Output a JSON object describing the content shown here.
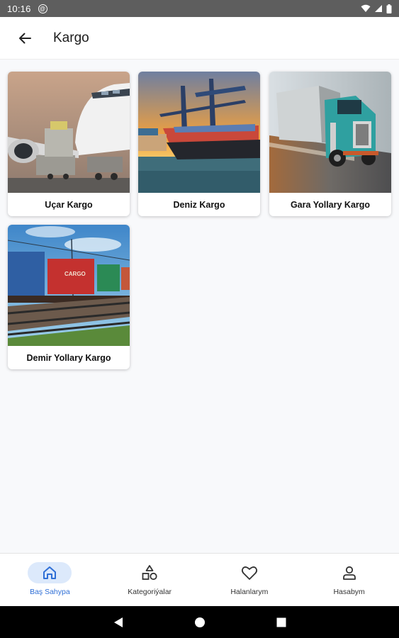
{
  "status_bar": {
    "time": "10:16",
    "notif_glyph": "@"
  },
  "app_bar": {
    "title": "Kargo"
  },
  "categories": [
    {
      "label": "Uçar Kargo",
      "image": "airplane-cargo-image"
    },
    {
      "label": "Deniz Kargo",
      "image": "ship-cargo-image"
    },
    {
      "label": "Gara Yollary Kargo",
      "image": "truck-cargo-image"
    },
    {
      "label": "Demir Yollary Kargo",
      "image": "train-cargo-image"
    }
  ],
  "train_container_text": [
    "CARGO"
  ],
  "bottom_nav": [
    {
      "label": "Baş Sahypa",
      "icon": "home-icon",
      "active": true
    },
    {
      "label": "Kategoriýalar",
      "icon": "shapes-icon",
      "active": false
    },
    {
      "label": "Halanlarym",
      "icon": "heart-icon",
      "active": false
    },
    {
      "label": "Hasabym",
      "icon": "person-icon",
      "active": false
    }
  ],
  "colors": {
    "accent": "#2f6fd6",
    "active_pill": "#dce9fb",
    "status_bar": "#5e5e5e"
  }
}
